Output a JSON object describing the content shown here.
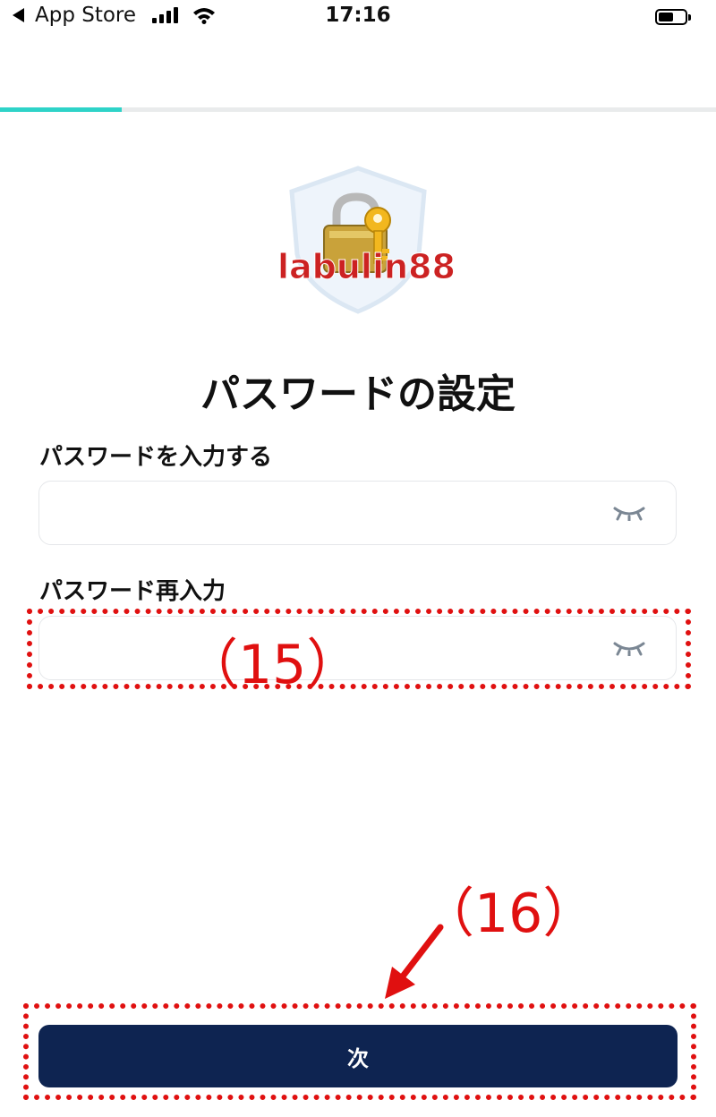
{
  "status_bar": {
    "back_app": "App Store",
    "time": "17:16"
  },
  "progress": {
    "fraction": 0.17,
    "color": "#2ed3c8"
  },
  "hero": {
    "icon": "shield-lock-key-icon",
    "watermark": "labulin88"
  },
  "title": "パスワードの設定",
  "fields": {
    "password": {
      "label": "パスワードを入力する",
      "value": "",
      "placeholder": ""
    },
    "confirm": {
      "label": "パスワード再入力",
      "value": "",
      "placeholder": ""
    }
  },
  "annotations": {
    "step15": "（15）",
    "step16": "（16）"
  },
  "next_button": {
    "label": "次"
  },
  "colors": {
    "accent": "#2ed3c8",
    "button": "#0e2451",
    "annotation": "#e01010"
  }
}
